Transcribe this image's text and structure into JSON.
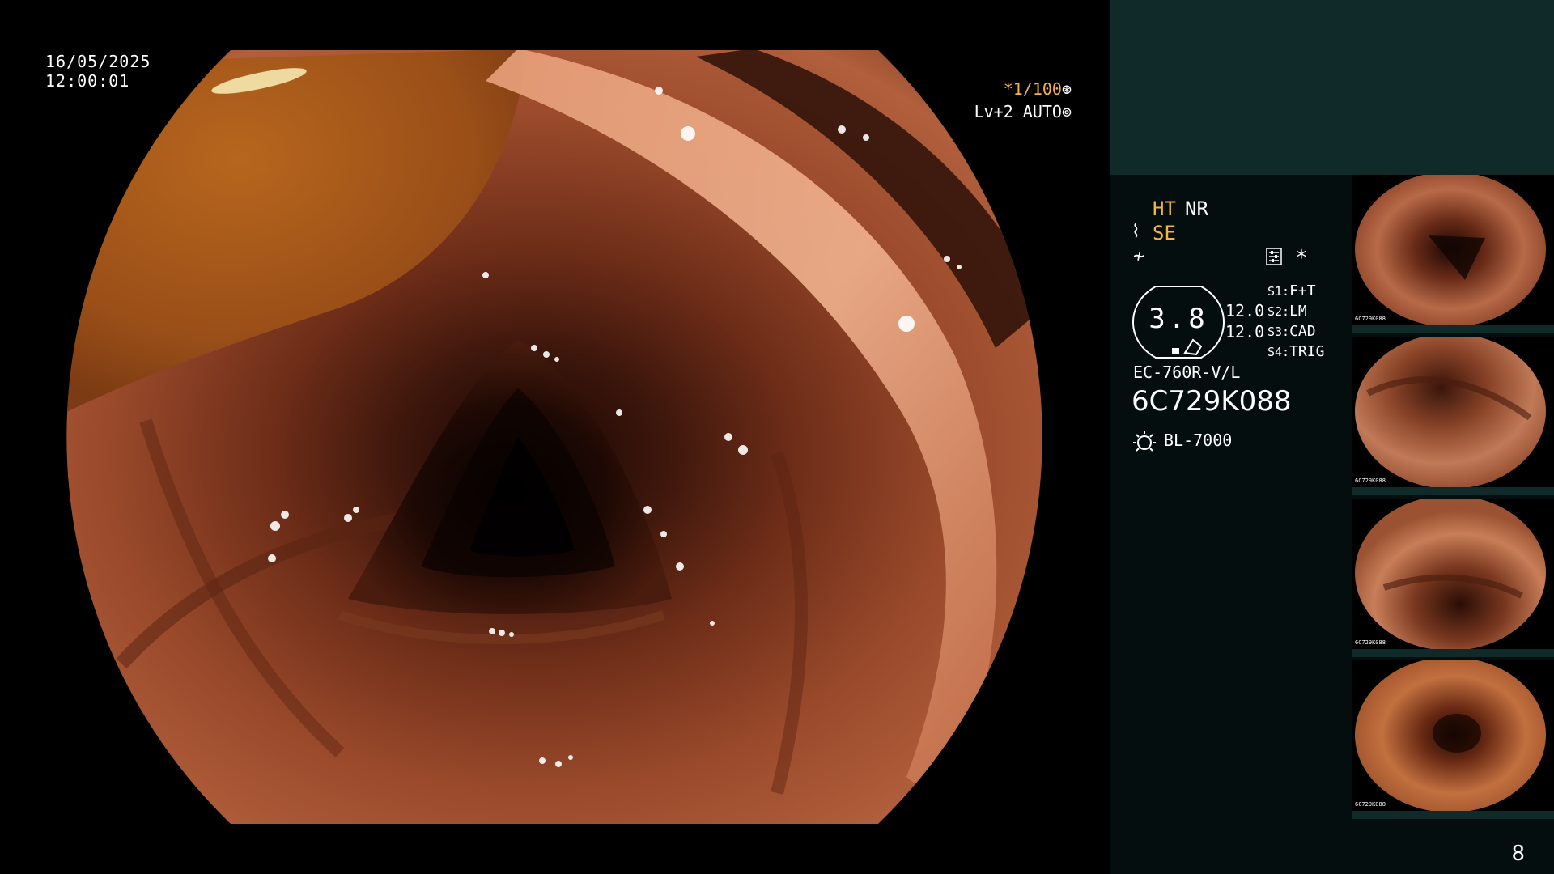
{
  "overlay": {
    "date": "16/05/2025",
    "time": "12:00:01",
    "shutter": "*1/100",
    "level": "Lv+2 AUTO"
  },
  "panel": {
    "ht": "HT",
    "nr": "NR",
    "se": "SE",
    "asterisk": "*",
    "gauge_value": "3.8",
    "gauge_val1": "12.0",
    "gauge_val2": "12.0",
    "switches": [
      {
        "key": "S1:",
        "value": "F+T"
      },
      {
        "key": "S2:",
        "value": "LM"
      },
      {
        "key": "S3:",
        "value": "CAD"
      },
      {
        "key": "S4:",
        "value": "TRIG"
      }
    ],
    "model": "EC-760R-V/L",
    "serial": "6C729K088",
    "light_source": "BL-7000",
    "page": "8"
  },
  "thumbnails": [
    {
      "label": "6C729K088"
    },
    {
      "label": "6C729K088"
    },
    {
      "label": "6C729K088"
    },
    {
      "label": "6C729K088"
    }
  ],
  "colors": {
    "accent_orange": "#f5b53a",
    "panel_bg": "#050e0e",
    "panel_top_bg": "#0f2a29"
  },
  "icons": [
    "shutter-mode-icon",
    "auto-iris-icon",
    "structure-enhancement-icon",
    "freeze-icon",
    "settings-icon",
    "light-source-icon"
  ]
}
